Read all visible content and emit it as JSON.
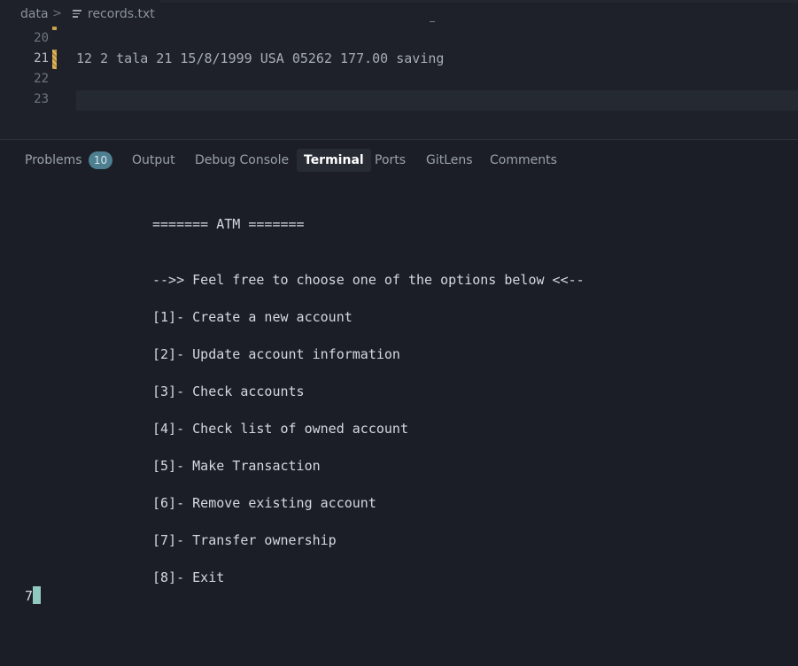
{
  "breadcrumb": {
    "folder": "data",
    "separator": ">",
    "file": "records.txt",
    "file_icon": "lines-file-icon"
  },
  "editor": {
    "lines": [
      {
        "number": "20",
        "text": ""
      },
      {
        "number": "21",
        "text": "12 2 tala 21 15/8/1999 USA 05262 177.00 saving"
      },
      {
        "number": "22",
        "text": ""
      },
      {
        "number": "23",
        "text": ""
      }
    ],
    "colors": {
      "background": "#1e2129",
      "line_number": "#6e7681",
      "modified_marker": "#c9a14a"
    }
  },
  "panel": {
    "tabs": [
      {
        "label": "Problems",
        "badge": "10",
        "active": false
      },
      {
        "label": "Output",
        "active": false
      },
      {
        "label": "Debug Console",
        "active": false
      },
      {
        "label": "Terminal",
        "active": true
      },
      {
        "label": "Ports",
        "active": false
      },
      {
        "label": "GitLens",
        "active": false
      },
      {
        "label": "Comments",
        "active": false
      }
    ],
    "colors": {
      "badge": "#4e7f91",
      "cursor": "#8fc9c0"
    }
  },
  "terminal": {
    "header": "======= ATM =======",
    "prompt": "-->> Feel free to choose one of the options below <<--",
    "options": [
      "[1]- Create a new account",
      "[2]- Update account information",
      "[3]- Check accounts",
      "[4]- Check list of owned account",
      "[5]- Make Transaction",
      "[6]- Remove existing account",
      "[7]- Transfer ownership",
      "[8]- Exit"
    ],
    "input": "7"
  }
}
